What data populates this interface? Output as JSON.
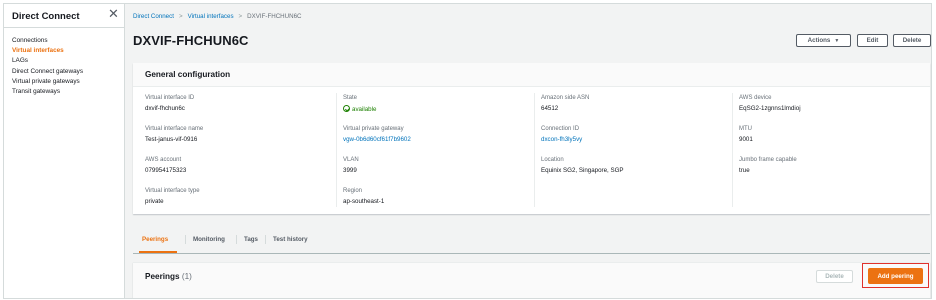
{
  "sidebar": {
    "title": "Direct Connect",
    "close_icon": "close-icon",
    "items": [
      {
        "label": "Connections"
      },
      {
        "label": "Virtual interfaces",
        "active": true
      },
      {
        "label": "LAGs"
      },
      {
        "label": "Direct Connect gateways"
      },
      {
        "label": "Virtual private gateways"
      },
      {
        "label": "Transit gateways"
      }
    ]
  },
  "breadcrumb": {
    "items": [
      "Direct Connect",
      "Virtual interfaces",
      "DXVIF-FHCHUN6C"
    ],
    "separator": ">"
  },
  "page": {
    "title": "DXVIF-FHCHUN6C",
    "actions_label": "Actions",
    "actions_caret": "▼",
    "edit_label": "Edit",
    "delete_label": "Delete"
  },
  "general": {
    "title": "General configuration",
    "columns": [
      [
        {
          "key": "Virtual interface ID",
          "value": "dxvif-fhchun6c"
        },
        {
          "key": "Virtual interface name",
          "value": "Test-janus-vif-0916"
        },
        {
          "key": "AWS account",
          "value": "079954175323"
        },
        {
          "key": "Virtual interface type",
          "value": "private"
        }
      ],
      [
        {
          "key": "State",
          "value": "available",
          "status": "ok"
        },
        {
          "key": "Virtual private gateway",
          "value": "vgw-0b6d60cf61f7b9602",
          "link": true
        },
        {
          "key": "VLAN",
          "value": "3999"
        },
        {
          "key": "Region",
          "value": "ap-southeast-1"
        }
      ],
      [
        {
          "key": "Amazon side ASN",
          "value": "64512"
        },
        {
          "key": "Connection ID",
          "value": "dxcon-fh3ly5vy",
          "link": true
        },
        {
          "key": "Location",
          "value": "Equinix SG2, Singapore, SGP"
        }
      ],
      [
        {
          "key": "AWS device",
          "value": "EqSG2-1zgnns1lmdioj"
        },
        {
          "key": "MTU",
          "value": "9001"
        },
        {
          "key": "Jumbo frame capable",
          "value": "true"
        }
      ]
    ]
  },
  "tabs": [
    {
      "label": "Peerings",
      "active": true
    },
    {
      "label": "Monitoring"
    },
    {
      "label": "Tags"
    },
    {
      "label": "Test history"
    }
  ],
  "peerings": {
    "title": "Peerings",
    "count": "(1)",
    "delete_label": "Delete",
    "add_label": "Add peering"
  },
  "colors": {
    "accent": "#ec7211",
    "link": "#0073bb",
    "success": "#1d8102",
    "highlight": "#e0312c"
  }
}
